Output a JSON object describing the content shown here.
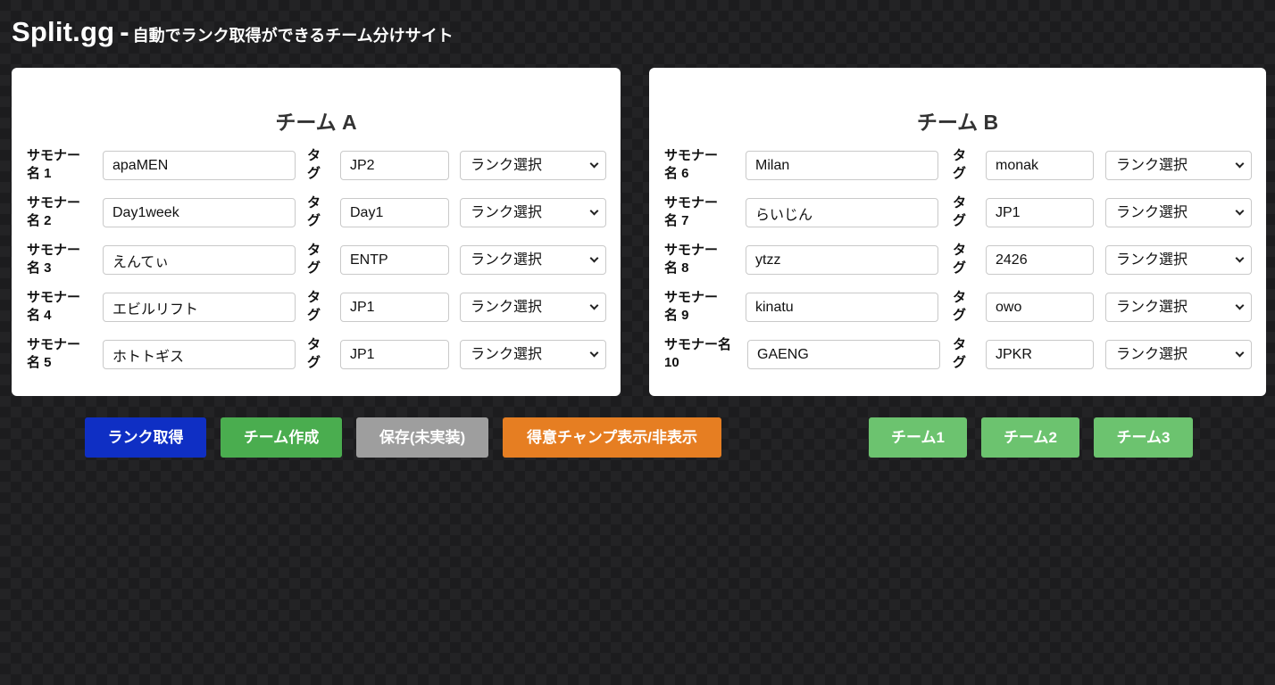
{
  "header": {
    "brand": "Split.gg",
    "separator": "-",
    "subtitle": "自動でランク取得ができるチーム分けサイト"
  },
  "teamA": {
    "title": "チーム A",
    "rows": [
      {
        "label_line1": "サモナー",
        "label_line2": "名 1",
        "name": "apaMEN",
        "tag_line1": "タ",
        "tag_line2": "グ",
        "tag": "JP2",
        "rank": "ランク選択"
      },
      {
        "label_line1": "サモナー",
        "label_line2": "名 2",
        "name": "Day1week",
        "tag_line1": "タ",
        "tag_line2": "グ",
        "tag": "Day1",
        "rank": "ランク選択"
      },
      {
        "label_line1": "サモナー",
        "label_line2": "名 3",
        "name": "えんてぃ",
        "tag_line1": "タ",
        "tag_line2": "グ",
        "tag": "ENTP",
        "rank": "ランク選択"
      },
      {
        "label_line1": "サモナー",
        "label_line2": "名 4",
        "name": "エビルリフト",
        "tag_line1": "タ",
        "tag_line2": "グ",
        "tag": "JP1",
        "rank": "ランク選択"
      },
      {
        "label_line1": "サモナー",
        "label_line2": "名 5",
        "name": "ホトトギス",
        "tag_line1": "タ",
        "tag_line2": "グ",
        "tag": "JP1",
        "rank": "ランク選択"
      }
    ]
  },
  "teamB": {
    "title": "チーム B",
    "rows": [
      {
        "label_line1": "サモナー",
        "label_line2": "名 6",
        "name": "Milan",
        "tag_line1": "タ",
        "tag_line2": "グ",
        "tag": "monak",
        "rank": "ランク選択"
      },
      {
        "label_line1": "サモナー",
        "label_line2": "名 7",
        "name": "らいじん",
        "tag_line1": "タ",
        "tag_line2": "グ",
        "tag": "JP1",
        "rank": "ランク選択"
      },
      {
        "label_line1": "サモナー",
        "label_line2": "名 8",
        "name": "ytzz",
        "tag_line1": "タ",
        "tag_line2": "グ",
        "tag": "2426",
        "rank": "ランク選択"
      },
      {
        "label_line1": "サモナー",
        "label_line2": "名 9",
        "name": "kinatu",
        "tag_line1": "タ",
        "tag_line2": "グ",
        "tag": "owo",
        "rank": "ランク選択"
      },
      {
        "label_line1": "サモナー名",
        "label_line2": "10",
        "name": "GAENG",
        "tag_line1": "タ",
        "tag_line2": "グ",
        "tag": "JPKR",
        "rank": "ランク選択"
      }
    ]
  },
  "buttons": {
    "get_rank": "ランク取得",
    "make_team": "チーム作成",
    "save": "保存(未実装)",
    "toggle_champ": "得意チャンプ表示/非表示",
    "team1": "チーム1",
    "team2": "チーム2",
    "team3": "チーム3"
  },
  "colors": {
    "background": "#1c1c1e",
    "panel": "#ffffff",
    "get_rank": "#0f2fc4",
    "make_team": "#4aad4f",
    "save": "#9e9e9e",
    "toggle_champ": "#e67e22",
    "team_buttons": "#6cc36f"
  }
}
